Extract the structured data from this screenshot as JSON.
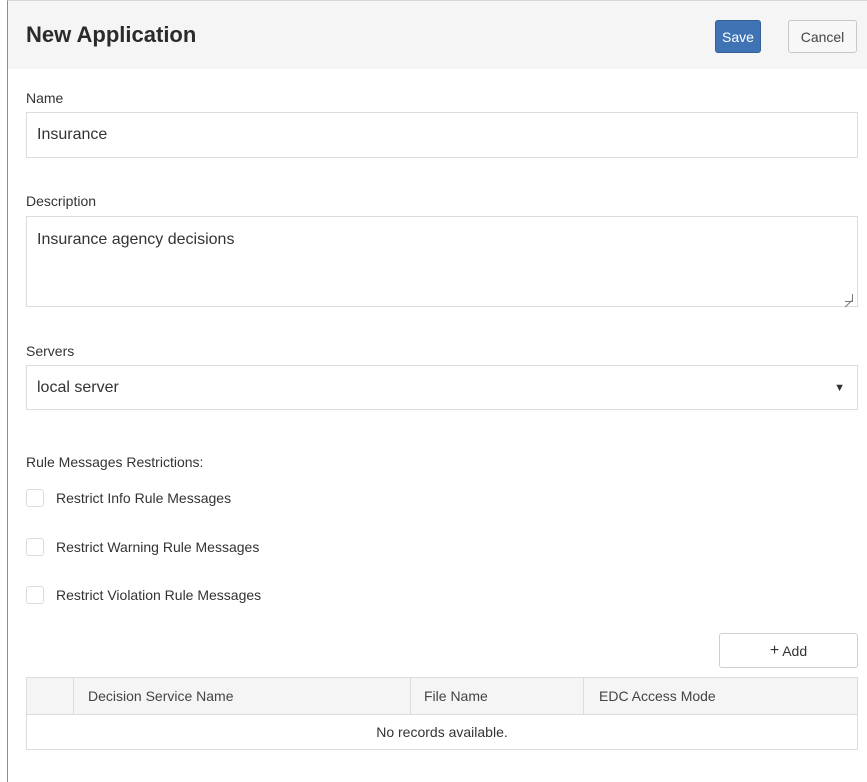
{
  "header": {
    "title": "New Application",
    "save_label": "Save",
    "cancel_label": "Cancel"
  },
  "form": {
    "name_label": "Name",
    "name_value": "Insurance",
    "description_label": "Description",
    "description_value": "Insurance agency decisions",
    "servers_label": "Servers",
    "servers_selected": "local server",
    "rule_messages_label": "Rule Messages Restrictions:",
    "restrictions": [
      {
        "label": "Restrict Info Rule Messages",
        "checked": false
      },
      {
        "label": "Restrict Warning Rule Messages",
        "checked": false
      },
      {
        "label": "Restrict Violation Rule Messages",
        "checked": false
      }
    ]
  },
  "grid": {
    "add_label": "Add",
    "columns": [
      "Decision Service Name",
      "File Name",
      "EDC Access Mode"
    ],
    "empty_message": "No records available."
  },
  "colors": {
    "primary": "#3f73b3",
    "header_bg": "#f5f5f5",
    "border": "#dcdcdc"
  }
}
